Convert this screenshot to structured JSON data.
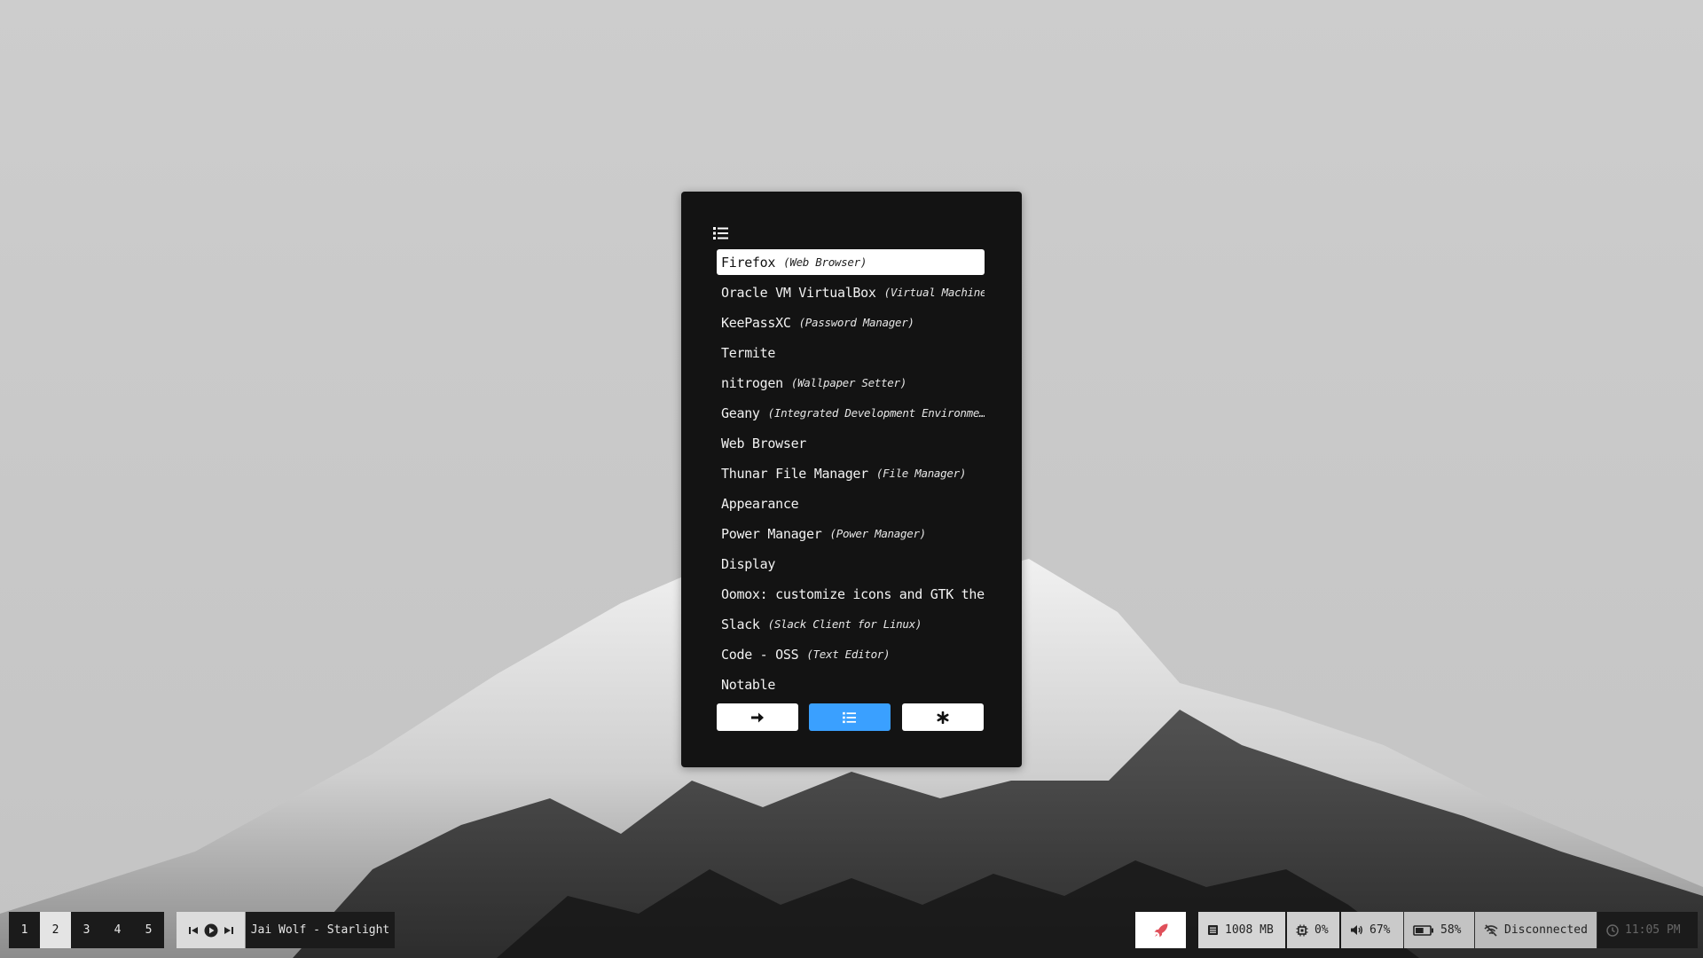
{
  "launcher": {
    "mode_icon": "list-icon",
    "items": [
      {
        "name": "Firefox",
        "desc": "(Web Browser)",
        "selected": true
      },
      {
        "name": "Oracle VM VirtualBox",
        "desc": "(Virtual Machine)"
      },
      {
        "name": "KeePassXC",
        "desc": "(Password Manager)"
      },
      {
        "name": "Termite",
        "desc": ""
      },
      {
        "name": "nitrogen",
        "desc": "(Wallpaper Setter)"
      },
      {
        "name": "Geany",
        "desc": "(Integrated Development Environme…"
      },
      {
        "name": "Web Browser",
        "desc": ""
      },
      {
        "name": "Thunar File Manager",
        "desc": "(File Manager)"
      },
      {
        "name": "Appearance",
        "desc": ""
      },
      {
        "name": "Power Manager",
        "desc": "(Power Manager)"
      },
      {
        "name": "Display",
        "desc": ""
      },
      {
        "name": "Oomox: customize icons and GTK them…",
        "desc": ""
      },
      {
        "name": "Slack",
        "desc": "(Slack Client for Linux)"
      },
      {
        "name": "Code - OSS",
        "desc": "(Text Editor)"
      },
      {
        "name": "Notable",
        "desc": ""
      }
    ],
    "mode_buttons": [
      {
        "id": "run",
        "icon": "arrow-right-icon",
        "active": false
      },
      {
        "id": "drun",
        "icon": "list-icon",
        "active": true
      },
      {
        "id": "window",
        "icon": "asterisk-icon",
        "active": false
      }
    ],
    "accent_color": "#3aa0ff"
  },
  "bar": {
    "workspaces": [
      "1",
      "2",
      "3",
      "4",
      "5"
    ],
    "active_workspace": "2",
    "media": {
      "prev_icon": "skip-back-icon",
      "play_icon": "play-icon",
      "next_icon": "skip-forward-icon",
      "now_playing": "Jai Wolf - Starlight"
    },
    "launcher_icon": "rocket-icon",
    "launcher_icon_color": "#e0505a",
    "memory": "1008 MB",
    "cpu": "0%",
    "volume": "67%",
    "battery": "58%",
    "battery_level": 0.58,
    "network": "Disconnected",
    "clock": "11:05 PM"
  }
}
